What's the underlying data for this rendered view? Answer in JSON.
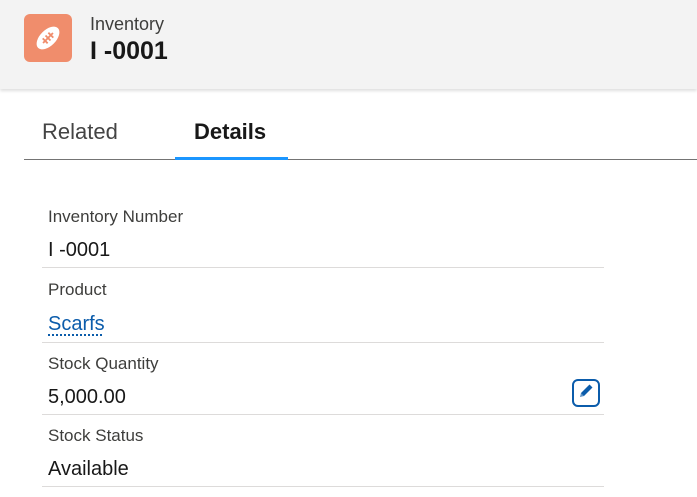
{
  "header": {
    "icon": "football-icon",
    "icon_color": "#f08d6c",
    "object_label": "Inventory",
    "record_name": "I -0001"
  },
  "tabs": [
    {
      "label": "Related",
      "active": false
    },
    {
      "label": "Details",
      "active": true
    }
  ],
  "accent_color": "#1b96ff",
  "fields": [
    {
      "label": "Inventory Number",
      "value": "I -0001"
    },
    {
      "label": "Product",
      "value": "Scarfs",
      "link": true
    },
    {
      "label": "Stock Quantity",
      "value": "5,000.00",
      "editable": true,
      "edit_icon": "pencil-icon"
    },
    {
      "label": "Stock Status",
      "value": "Available"
    }
  ]
}
